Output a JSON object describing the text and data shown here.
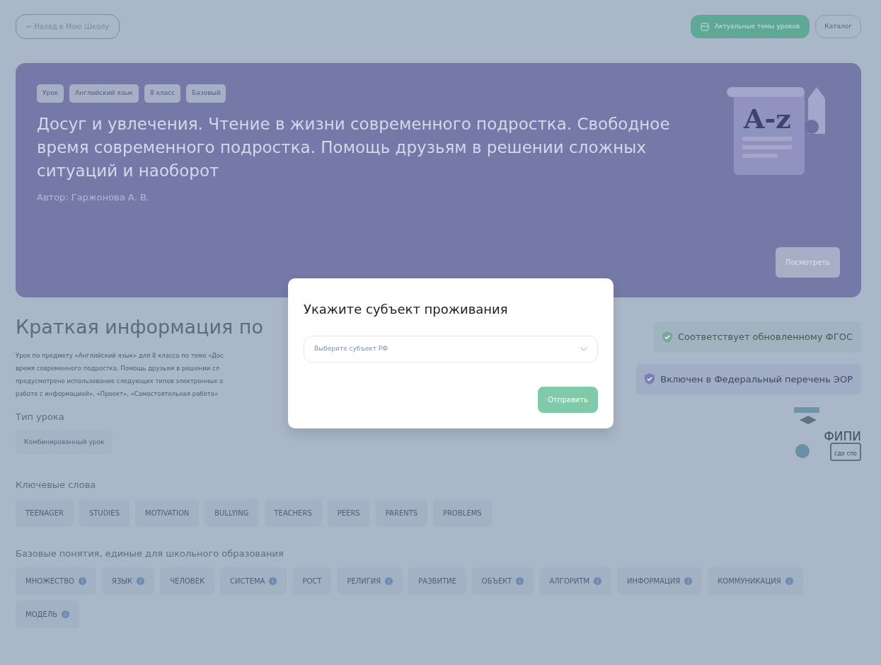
{
  "top_bar": {
    "back_link": "← Назад в Мою Школу",
    "buttons": [
      {
        "label": "Актуальные темы уроков",
        "kind": "primary"
      },
      {
        "label": "Каталог",
        "kind": "outline"
      }
    ]
  },
  "lesson": {
    "tags": [
      "Урок",
      "Английский язык",
      "8 класс",
      "Базовый"
    ],
    "title": "Досуг и увлечения. Чтение в жизни современного подростка. Свободное время современного подростка. Помощь друзьям в решении сложных ситуаций и наоборот",
    "author": "Автор: Гаржонова А. В.",
    "view_button": "Посмотреть",
    "illustration_text": "A-z"
  },
  "summary": {
    "heading": "Краткая информация по",
    "description_lines": [
      "Урок по предмету «Английский язык» для 8 класса по теме «Дос",
      "время современного подростка. Помощь друзьям в решении сл",
      "предусмотрено использование следующих типов электронных о",
      "работе с информацией», «Проект», «Самостоятельная работа»"
    ],
    "logo": {
      "name": "ФИПИ",
      "caption": "сдо спо"
    },
    "badges": [
      {
        "label": "Соответствует обновленному ФГОС",
        "color": "#77a89a"
      },
      {
        "label": "Включен в Федеральный перечень ЭОР",
        "color": "#7b80b6"
      }
    ]
  },
  "lesson_type": {
    "label": "Тип урока",
    "value": "Комбинированный урок"
  },
  "keywords": {
    "label": "Ключевые слова",
    "items": [
      "TEENAGER",
      "STUDIES",
      "MOTIVATION",
      "BULLYING",
      "TEACHERS",
      "PEERS",
      "PARENTS",
      "PROBLEMS"
    ]
  },
  "concepts": {
    "label": "Базовые понятия, единые для школьного образования",
    "items": [
      {
        "label": "МНОЖЕСТВО",
        "info": true
      },
      {
        "label": "ЯЗЫК",
        "info": true
      },
      {
        "label": "ЧЕЛОВЕК",
        "info": false
      },
      {
        "label": "СИСТЕМА",
        "info": true
      },
      {
        "label": "РОСТ",
        "info": false
      },
      {
        "label": "РЕЛИГИЯ",
        "info": true
      },
      {
        "label": "РАЗВИТИЕ",
        "info": false
      },
      {
        "label": "ОБЪЕКТ",
        "info": true
      },
      {
        "label": "АЛГОРИТМ",
        "info": true
      },
      {
        "label": "ИНФОРМАЦИЯ",
        "info": true
      },
      {
        "label": "КОММУНИКАЦИЯ",
        "info": true
      },
      {
        "label": "МОДЕЛЬ",
        "info": true
      }
    ]
  },
  "modal": {
    "title": "Укажите субъект проживания",
    "select": {
      "placeholder": "Выберите субъект РФ"
    },
    "submit": {
      "label": "Отправить",
      "disabled": true
    }
  }
}
